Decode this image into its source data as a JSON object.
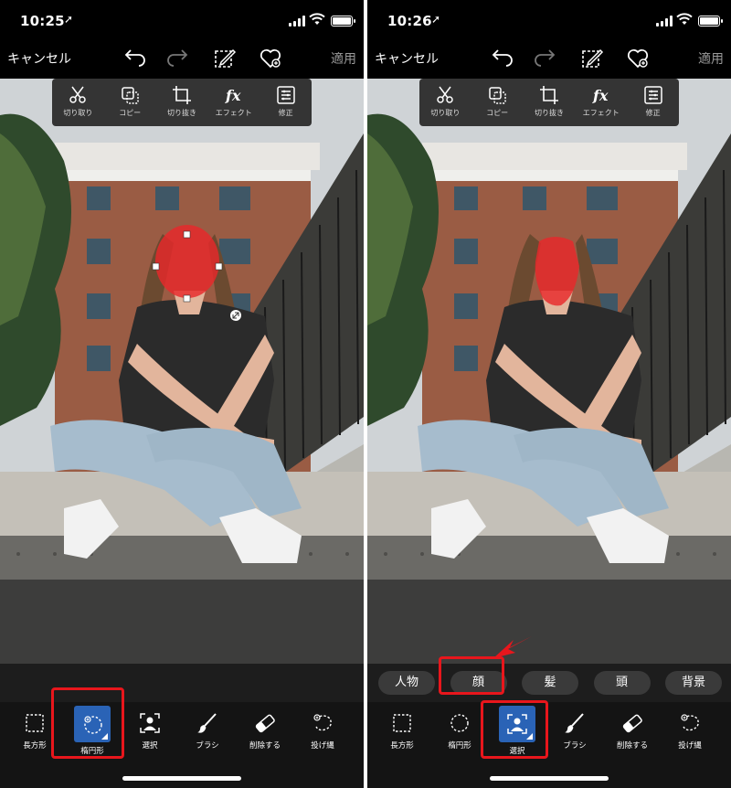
{
  "colors": {
    "accent": "#2a63b6",
    "highlight": "#e8161c",
    "mask": "#e8282b"
  },
  "left": {
    "status": {
      "time": "10:25"
    },
    "topbar": {
      "cancel": "キャンセル",
      "apply": "適用"
    },
    "edit_menu": [
      "切り取り",
      "コピー",
      "切り抜き",
      "エフェクト",
      "修正"
    ],
    "tools": [
      "長方形",
      "楕円形",
      "選択",
      "ブラシ",
      "削除する",
      "投げ縄"
    ],
    "active_tool": "楕円形"
  },
  "right": {
    "status": {
      "time": "10:26"
    },
    "topbar": {
      "cancel": "キャンセル",
      "apply": "適用"
    },
    "edit_menu": [
      "切り取り",
      "コピー",
      "切り抜き",
      "エフェクト",
      "修正"
    ],
    "chips": [
      "人物",
      "顔",
      "髪",
      "頭",
      "背景"
    ],
    "highlighted_chip": "顔",
    "tools": [
      "長方形",
      "楕円形",
      "選択",
      "ブラシ",
      "削除する",
      "投げ縄"
    ],
    "active_tool": "選択"
  }
}
